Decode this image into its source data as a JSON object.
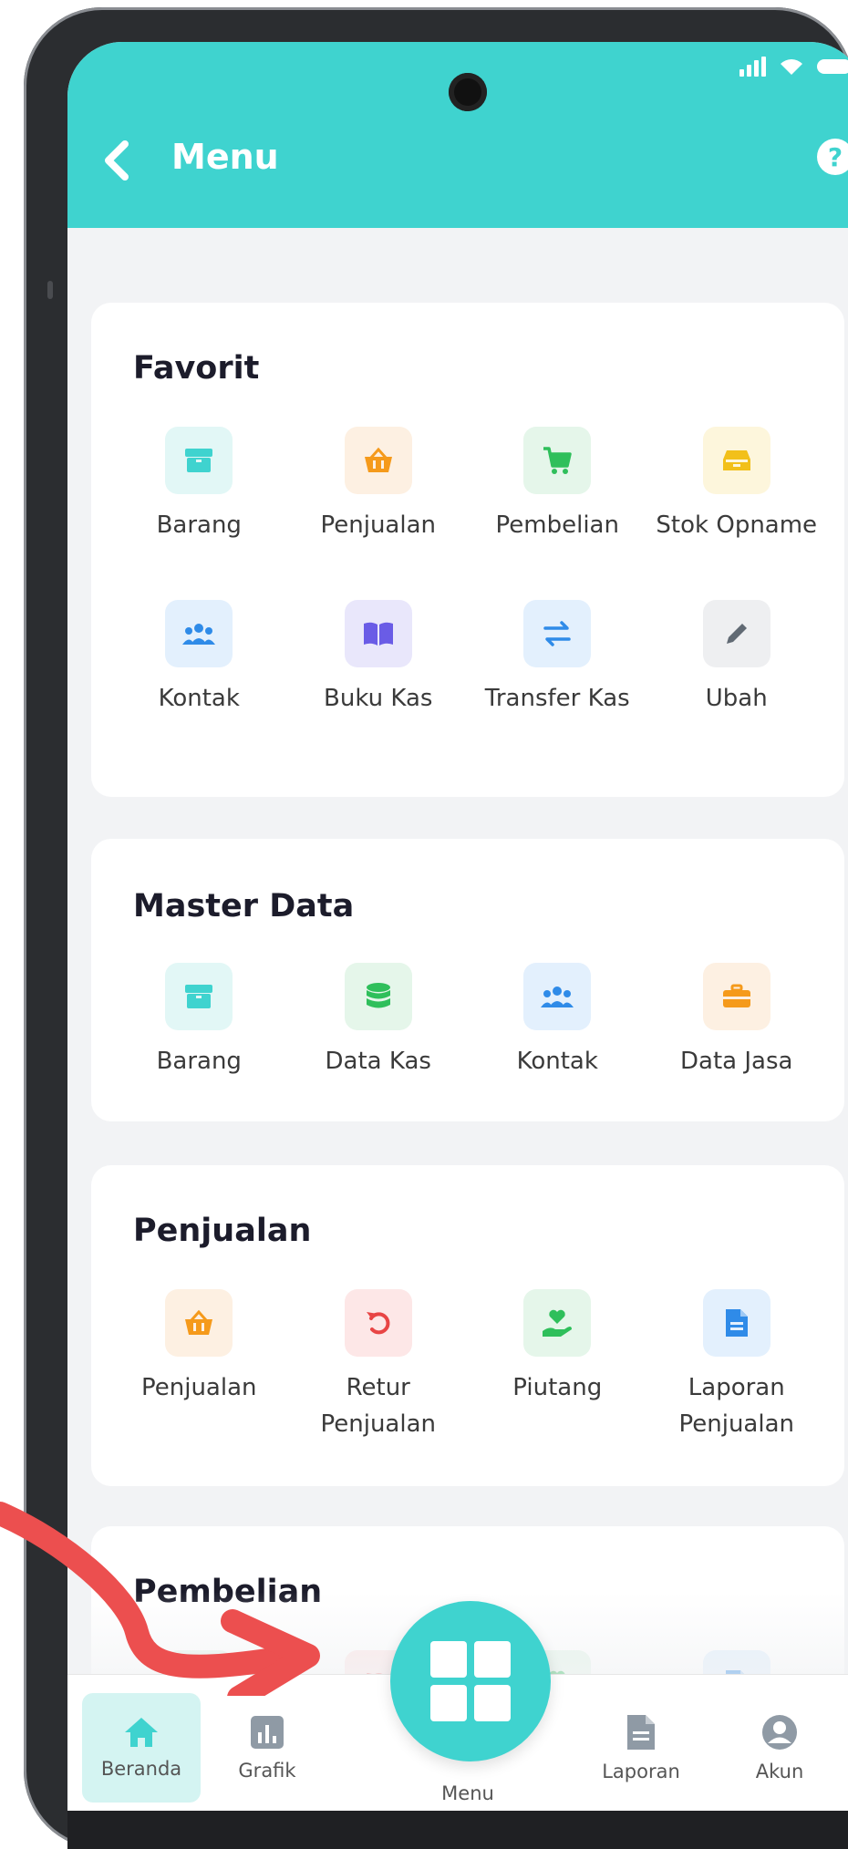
{
  "header": {
    "title": "Menu",
    "help": "?"
  },
  "sections": [
    {
      "title": "Favorit",
      "items": [
        {
          "label": "Barang",
          "icon": "box-icon"
        },
        {
          "label": "Penjualan",
          "icon": "basket-icon"
        },
        {
          "label": "Pembelian",
          "icon": "cart-icon"
        },
        {
          "label": "Stok Opname",
          "icon": "drawer-icon"
        },
        {
          "label": "Kontak",
          "icon": "people-icon"
        },
        {
          "label": "Buku Kas",
          "icon": "book-icon"
        },
        {
          "label": "Transfer Kas",
          "icon": "transfer-icon"
        },
        {
          "label": "Ubah",
          "icon": "pencil-icon"
        }
      ]
    },
    {
      "title": "Master Data",
      "items": [
        {
          "label": "Barang",
          "icon": "box-icon"
        },
        {
          "label": "Data Kas",
          "icon": "database-icon"
        },
        {
          "label": "Kontak",
          "icon": "people-icon"
        },
        {
          "label": "Data Jasa",
          "icon": "briefcase-icon"
        }
      ]
    },
    {
      "title": "Penjualan",
      "items": [
        {
          "label": "Penjualan",
          "icon": "basket-icon"
        },
        {
          "label": "Retur Penjualan",
          "icon": "return-icon"
        },
        {
          "label": "Piutang",
          "icon": "hand-heart-icon"
        },
        {
          "label": "Laporan Penjualan",
          "icon": "document-icon"
        }
      ]
    },
    {
      "title": "Pembelian",
      "items": [
        {
          "label": "",
          "icon": "cart-icon"
        },
        {
          "label": "",
          "icon": "return-icon"
        },
        {
          "label": "",
          "icon": "hand-heart-icon"
        },
        {
          "label": "",
          "icon": "document-icon"
        }
      ]
    }
  ],
  "bottom_nav": [
    {
      "label": "Beranda",
      "icon": "home-icon",
      "active": true
    },
    {
      "label": "Grafik",
      "icon": "bar-chart-icon",
      "active": false
    },
    {
      "label": "Menu",
      "icon": "grid-icon",
      "active": false
    },
    {
      "label": "Laporan",
      "icon": "report-icon",
      "active": false
    },
    {
      "label": "Akun",
      "icon": "account-icon",
      "active": false
    }
  ],
  "colors": {
    "accent": "#3fd3cf",
    "arrow": "#ec4f4f"
  }
}
